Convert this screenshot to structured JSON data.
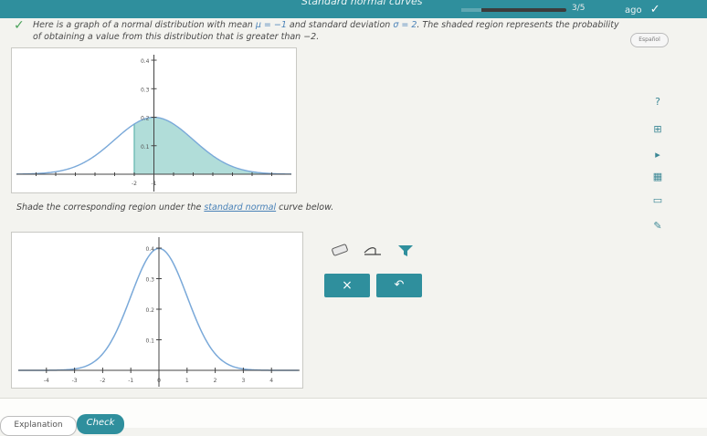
{
  "header": {
    "topic": "Standard normal curves",
    "progress": {
      "count": "3/5",
      "segments_filled": 1,
      "segments_total": 5
    },
    "language": "ago"
  },
  "prompt": {
    "part1": "Here is a graph of a normal distribution with mean ",
    "mean": "μ = −1",
    "part2": " and standard deviation ",
    "sd": "σ = 2",
    "part3": ". The shaded region represents the probability of obtaining a value from this distribution that is greater than −2."
  },
  "espanol": "Español",
  "graph1": {
    "y_labels": [
      "0.4",
      "0.3",
      "0.2",
      "0.1"
    ],
    "x_labels": [
      "-2",
      "-1"
    ]
  },
  "instruction": {
    "before": "Shade the corresponding region under the ",
    "link": "standard normal",
    "after": " curve below."
  },
  "graph2": {
    "y_labels": [
      "0.4",
      "0.3",
      "0.2",
      "0.1"
    ],
    "x_labels": [
      "-4",
      "-3",
      "-2",
      "-1",
      "0",
      "1",
      "2",
      "3",
      "4"
    ]
  },
  "tools": {
    "clear_label": "×",
    "undo_label": "↶"
  },
  "sidebar": {
    "help": "?",
    "calc": "⊞",
    "play": "▸",
    "table": "▦",
    "book": "▭",
    "edit": "✎"
  },
  "footer": {
    "explanation": "Explanation",
    "check": "Check"
  },
  "chart_data": [
    {
      "type": "area",
      "curve": "normal",
      "mean": -1,
      "sd": 2,
      "shaded_greater_than": -2,
      "y_ticks": [
        0.1,
        0.2,
        0.3,
        0.4
      ],
      "x_ticks_labeled": [
        -2,
        -1
      ],
      "colors": {
        "curve": "#7aa9d9",
        "shade": "#9ed5d0"
      }
    },
    {
      "type": "line",
      "curve": "standard normal",
      "mean": 0,
      "sd": 1,
      "y_ticks": [
        0.1,
        0.2,
        0.3,
        0.4
      ],
      "x_ticks": [
        -4,
        -3,
        -2,
        -1,
        0,
        1,
        2,
        3,
        4
      ],
      "colors": {
        "curve": "#7aa9d9"
      }
    }
  ]
}
